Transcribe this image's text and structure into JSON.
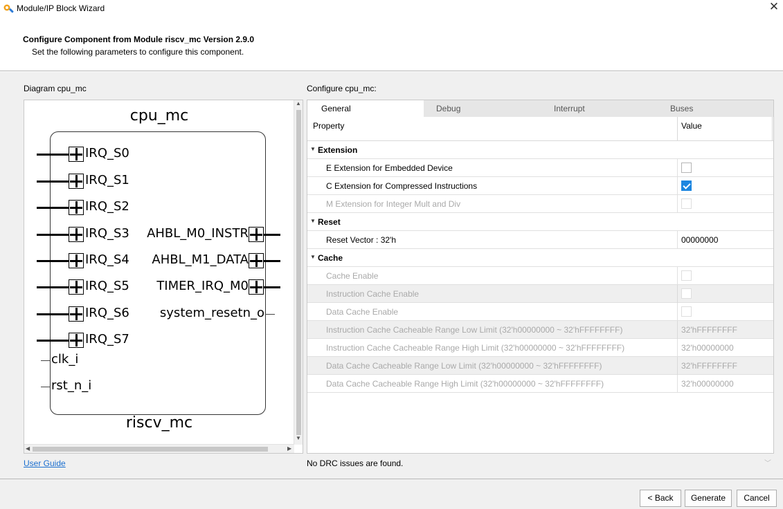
{
  "window": {
    "title": "Module/IP Block Wizard",
    "close_symbol": "✕",
    "app_icon": "wizard-icon"
  },
  "header": {
    "title": "Configure Component from Module riscv_mc Version 2.9.0",
    "subtitle": "Set the following parameters to configure this component."
  },
  "diagram": {
    "label": "Diagram cpu_mc",
    "instance_name": "cpu_mc",
    "module_name": "riscv_mc",
    "left_pins": [
      "IRQ_S0",
      "IRQ_S1",
      "IRQ_S2",
      "IRQ_S3",
      "IRQ_S4",
      "IRQ_S5",
      "IRQ_S6",
      "IRQ_S7",
      "clk_i",
      "rst_n_i"
    ],
    "right_pins": [
      "AHBL_M0_INSTR",
      "AHBL_M1_DATA",
      "TIMER_IRQ_M0",
      "system_resetn_o"
    ]
  },
  "config": {
    "label": "Configure cpu_mc:",
    "tabs": [
      "General",
      "Debug",
      "Interrupt",
      "Buses"
    ],
    "active_tab": "General",
    "columns": {
      "property": "Property",
      "value": "Value"
    },
    "groups": {
      "extension": "Extension",
      "reset": "Reset",
      "cache": "Cache"
    },
    "rows": {
      "e_ext": {
        "name": "E Extension for Embedded Device",
        "checked": false
      },
      "c_ext": {
        "name": "C Extension for Compressed Instructions",
        "checked": true
      },
      "m_ext": {
        "name": "M Extension for Integer Mult and Div",
        "checked": false
      },
      "reset_vector": {
        "name": "Reset Vector : 32'h",
        "value": "00000000"
      },
      "cache_enable": {
        "name": "Cache Enable"
      },
      "icache_enable": {
        "name": "Instruction Cache Enable"
      },
      "dcache_enable": {
        "name": "Data Cache Enable"
      },
      "icache_low": {
        "name": "Instruction Cache Cacheable Range Low Limit (32'h00000000 ~ 32'hFFFFFFFF)",
        "value": "32'hFFFFFFFF"
      },
      "icache_high": {
        "name": "Instruction Cache Cacheable Range High Limit (32'h00000000 ~ 32'hFFFFFFFF)",
        "value": "32'h00000000"
      },
      "dcache_low": {
        "name": "Data Cache Cacheable Range Low Limit (32'h00000000 ~ 32'hFFFFFFFF)",
        "value": "32'hFFFFFFFF"
      },
      "dcache_high": {
        "name": "Data Cache Cacheable Range High Limit (32'h00000000 ~ 32'hFFFFFFFF)",
        "value": "32'h00000000"
      }
    }
  },
  "links": {
    "user_guide": "User Guide"
  },
  "status": {
    "drc": "No DRC issues are found."
  },
  "buttons": {
    "back": "< Back",
    "generate": "Generate",
    "cancel": "Cancel"
  },
  "colors": {
    "accent": "#1c86e0",
    "link": "#1a6fcf",
    "disabled_text": "#a9a9a9",
    "panel_bg": "#f0f0f0"
  }
}
